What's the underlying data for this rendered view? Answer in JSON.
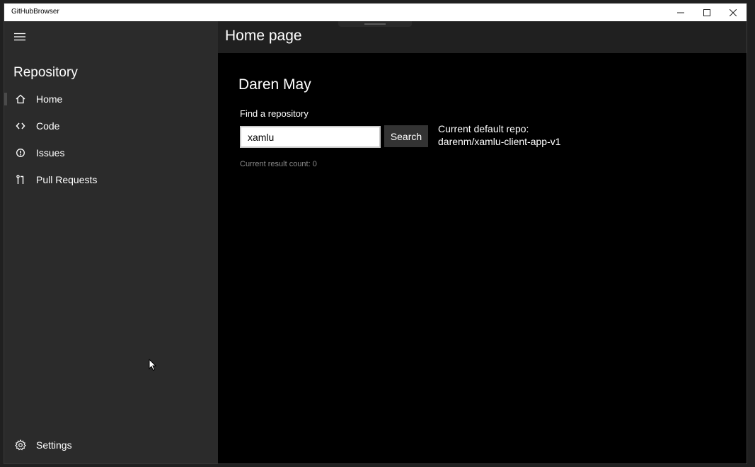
{
  "window": {
    "title": "GitHubBrowser"
  },
  "pane": {
    "header": "Repository",
    "items": [
      {
        "label": "Home",
        "icon": "home-icon",
        "selected": true
      },
      {
        "label": "Code",
        "icon": "code-icon",
        "selected": false
      },
      {
        "label": "Issues",
        "icon": "issues-icon",
        "selected": false
      },
      {
        "label": "Pull Requests",
        "icon": "pull-request-icon",
        "selected": false
      }
    ],
    "settings_label": "Settings"
  },
  "content": {
    "page_title": "Home page",
    "user_name": "Daren May",
    "find_label": "Find a repository",
    "search_value": "xamlu",
    "search_button": "Search",
    "default_repo_label": "Current default repo:",
    "default_repo_value": "darenm/xamlu-client-app-v1",
    "result_count": "Current result count: 0"
  },
  "colors": {
    "pane_bg": "#2b2b2b",
    "content_bg": "#000000",
    "header_bg": "#202020",
    "button_bg": "#333333",
    "titlebar_bg": "#ffffff"
  }
}
